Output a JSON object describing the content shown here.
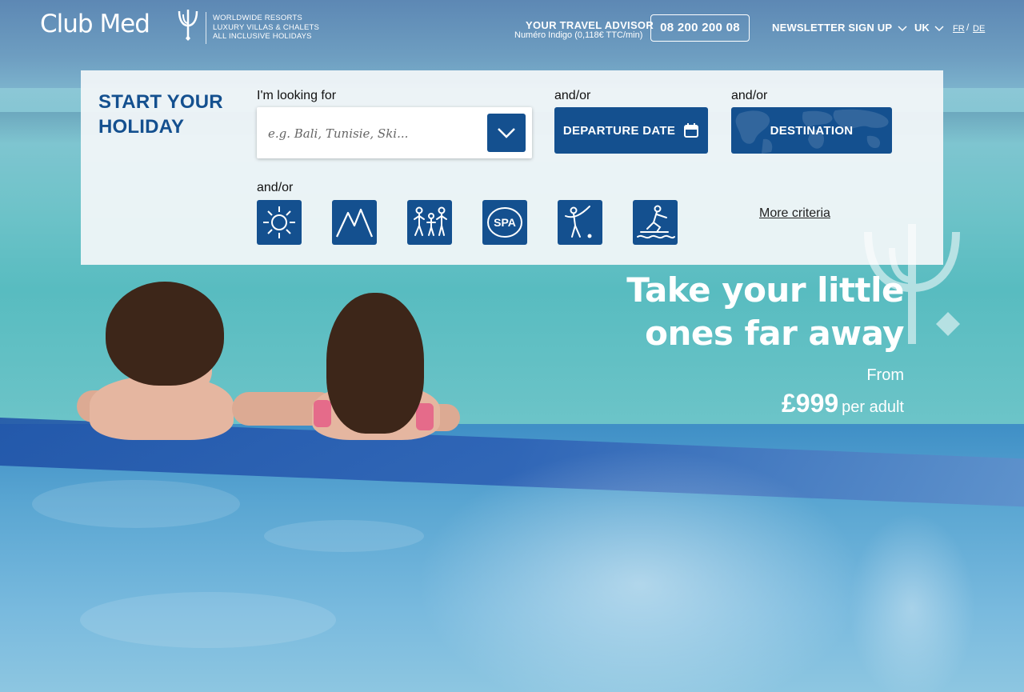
{
  "header": {
    "logo_text": "Club Med",
    "tagline": [
      "WORLDWIDE RESORTS",
      "LUXURY VILLAS & CHALETS",
      "ALL INCLUSIVE HOLIDAYS"
    ],
    "advisor_title": "YOUR TRAVEL ADVISOR",
    "advisor_subtitle": "Numéro Indigo (0,118€ TTC/min)",
    "phone": "08 200 200 08",
    "newsletter_label": "NEWSLETTER SIGN UP",
    "current_country": "UK",
    "languages": [
      "FR",
      "DE"
    ],
    "language_separator": "/"
  },
  "search_panel": {
    "title_line1": "START YOUR",
    "title_line2": "HOLIDAY",
    "looking_for_label": "I'm looking for",
    "search_placeholder": "e.g. Bali, Tunisie, Ski...",
    "andor_1": "and/or",
    "andor_2": "and/or",
    "andor_3": "and/or",
    "departure_label": "DEPARTURE DATE",
    "destination_label": "DESTINATION",
    "activity_icons": [
      "sun-icon",
      "mountain-icon",
      "family-icon",
      "spa-icon",
      "golf-icon",
      "waterski-icon"
    ],
    "spa_text": "SPA",
    "more_criteria": "More criteria"
  },
  "promo": {
    "title_line1": "Take your little",
    "title_line2": "ones far away",
    "from_label": "From",
    "price": "£999",
    "price_unit": "per adult"
  },
  "colors": {
    "brand_blue": "#14508f",
    "panel_bg": "#f3f6f9"
  }
}
